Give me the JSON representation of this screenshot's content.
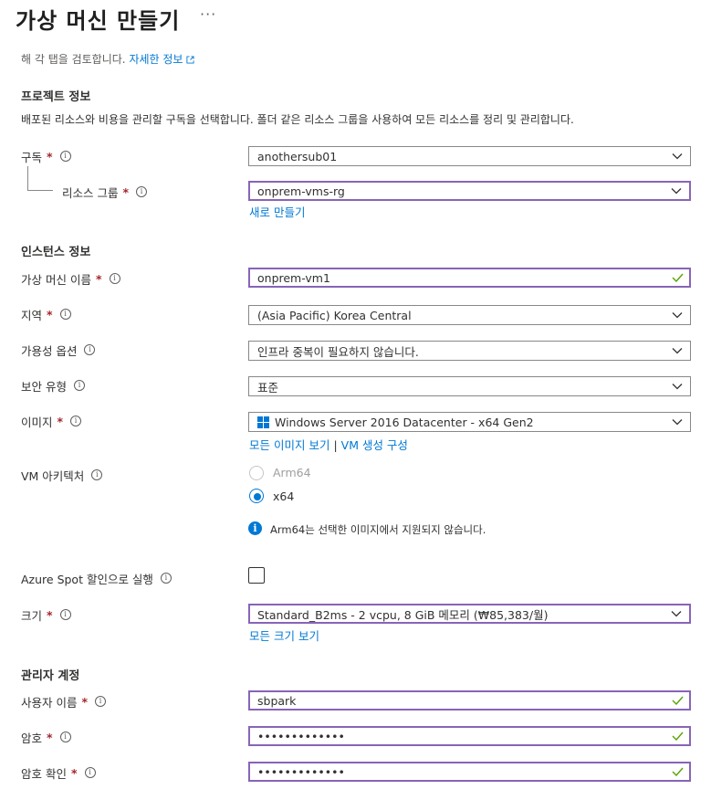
{
  "page": {
    "title": "가상 머신 만들기",
    "more_label": "···",
    "intro_text": "해 각 탭을 검토합니다.",
    "intro_link": "자세한 정보",
    "external_icon": "external-link-icon"
  },
  "project": {
    "heading": "프로젝트 정보",
    "description": "배포된 리소스와 비용을 관리할 구독을 선택합니다. 폴더 같은 리소스 그룹을 사용하여 모든 리소스를 정리 및 관리합니다.",
    "subscription": {
      "label": "구독",
      "required": "*",
      "value": "anothersub01"
    },
    "resource_group": {
      "label": "리소스 그룹",
      "required": "*",
      "value": "onprem-vms-rg",
      "create_new": "새로 만들기"
    }
  },
  "instance": {
    "heading": "인스턴스 정보",
    "vm_name": {
      "label": "가상 머신 이름",
      "required": "*",
      "value": "onprem-vm1"
    },
    "region": {
      "label": "지역",
      "required": "*",
      "value": "(Asia Pacific) Korea Central"
    },
    "availability": {
      "label": "가용성 옵션",
      "value": "인프라 중복이 필요하지 않습니다."
    },
    "security_type": {
      "label": "보안 유형",
      "value": "표준"
    },
    "image": {
      "label": "이미지",
      "required": "*",
      "value": "Windows Server 2016 Datacenter - x64 Gen2",
      "link_all": "모든 이미지 보기",
      "link_sep": "|",
      "link_config": "VM 생성 구성"
    },
    "architecture": {
      "label": "VM 아키텍처",
      "options": [
        {
          "label": "Arm64",
          "selected": false,
          "disabled": true
        },
        {
          "label": "x64",
          "selected": true,
          "disabled": false
        }
      ],
      "note": "Arm64는 선택한 이미지에서 지원되지 않습니다."
    },
    "spot": {
      "label": "Azure Spot 할인으로 실행",
      "checked": false
    },
    "size": {
      "label": "크기",
      "required": "*",
      "value": "Standard_B2ms - 2 vcpu, 8 GiB 메모리 (₩85,383/월)",
      "link_all": "모든 크기 보기"
    }
  },
  "admin": {
    "heading": "관리자 계정",
    "username": {
      "label": "사용자 이름",
      "required": "*",
      "value": "sbpark"
    },
    "password": {
      "label": "암호",
      "required": "*",
      "value": "•••••••••••••"
    },
    "confirm": {
      "label": "암호 확인",
      "required": "*",
      "value": "•••••••••••••"
    }
  },
  "colors": {
    "accent": "#0078d4",
    "focus": "#8764b8",
    "valid": "#57a300",
    "required": "#a4262c"
  }
}
